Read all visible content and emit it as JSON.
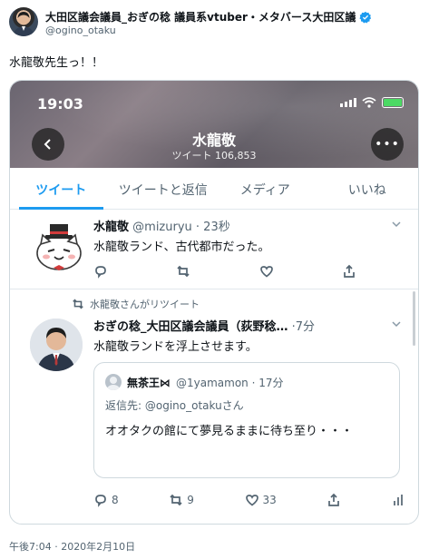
{
  "outer": {
    "display_name": "大田区議会議員_おぎの稔 議員系vtuber・メタバース大田区議",
    "handle": "@ogino_otaku",
    "text": "水龍敬先生っ！！",
    "timestamp": "午後7:04 · 2020年2月10日",
    "verified_color": "#1d9bf0"
  },
  "phone": {
    "status_time": "19:03",
    "profile_name": "水龍敬",
    "tweet_count": "ツイート 106,853",
    "battery_color": "#4cd964",
    "tabs": [
      "ツイート",
      "ツイートと返信",
      "メディア",
      "いいね"
    ],
    "active_tab": "ツイート",
    "tweet1": {
      "name": "水龍敬",
      "handle_time": "@mizuryu · 23秒",
      "text": "水龍敬ランド、古代都市だった。"
    },
    "tweet2": {
      "retweet_label": "水龍敬さんがリツイート",
      "name": "おぎの稔_大田区議会議員（荻野稔…",
      "time": "·7分",
      "text": "水龍敬ランドを浮上させます。",
      "quote": {
        "name": "無茶王⋈",
        "handle_time": "@1yamamon · 17分",
        "reply_to": "返信先: @ogino_otakuさん",
        "text": "オオタクの館にて夢見るままに待ち至り・・・"
      },
      "replies": "8",
      "retweets": "9",
      "likes": "33"
    },
    "accent": "#1d9bf0"
  }
}
